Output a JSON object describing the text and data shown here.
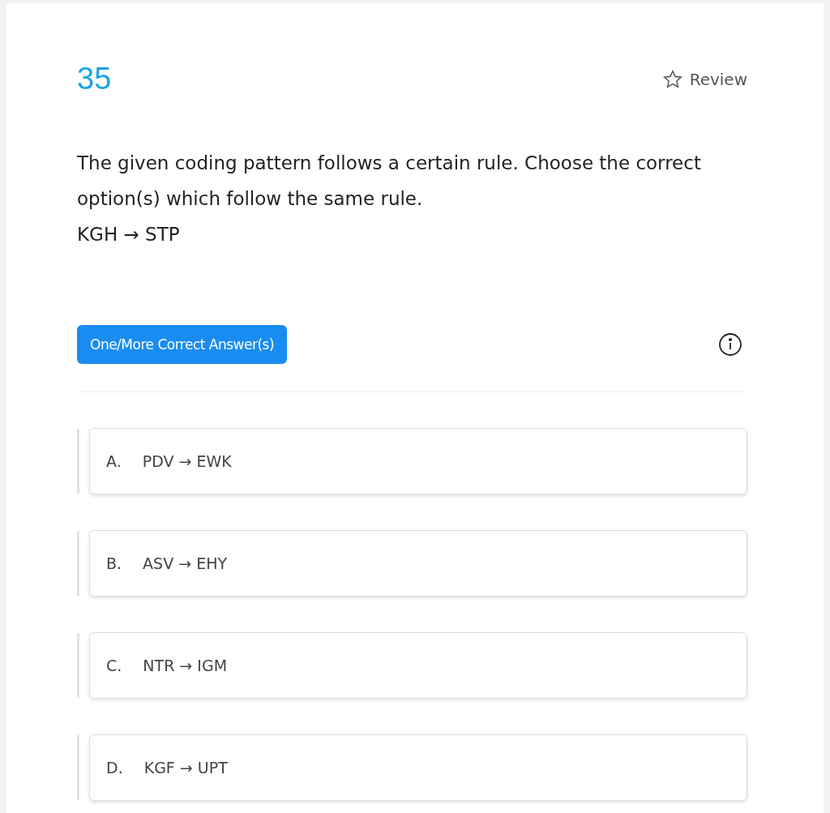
{
  "question": {
    "number": "35",
    "review": "Review",
    "text": [
      "The given coding pattern follows a certain rule. Choose the correct option(s) which follow the same rule.",
      "KGH → STP"
    ]
  },
  "answer_type": "One/More Correct Answer(s)",
  "options": [
    {
      "letter": "A.",
      "text": "PDV → EWK"
    },
    {
      "letter": "B.",
      "text": "ASV → EHY"
    },
    {
      "letter": "C.",
      "text": "NTR → IGM"
    },
    {
      "letter": "D.",
      "text": "KGF → UPT"
    }
  ]
}
